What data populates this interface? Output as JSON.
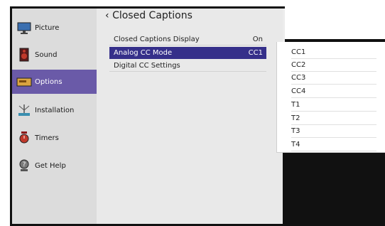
{
  "sidebar": {
    "items": [
      {
        "label": "Picture",
        "icon": "monitor-icon"
      },
      {
        "label": "Sound",
        "icon": "speaker-icon"
      },
      {
        "label": "Options",
        "icon": "options-icon"
      },
      {
        "label": "Installation",
        "icon": "installation-icon"
      },
      {
        "label": "Timers",
        "icon": "timer-icon"
      },
      {
        "label": "Get Help",
        "icon": "help-icon"
      }
    ],
    "active_index": 2
  },
  "header": {
    "title": "Closed Captions"
  },
  "menu": {
    "rows": [
      {
        "label": "Closed Captions Display",
        "value": "On"
      },
      {
        "label": "Analog CC Mode",
        "value": "CC1"
      },
      {
        "label": "Digital CC Settings",
        "value": ""
      }
    ],
    "selected_index": 1
  },
  "dropdown": {
    "options": [
      "CC1",
      "CC2",
      "CC3",
      "CC4",
      "T1",
      "T2",
      "T3",
      "T4"
    ]
  },
  "colors": {
    "active_sidebar": "#6a5aa8",
    "selected_row": "#352f8a"
  }
}
